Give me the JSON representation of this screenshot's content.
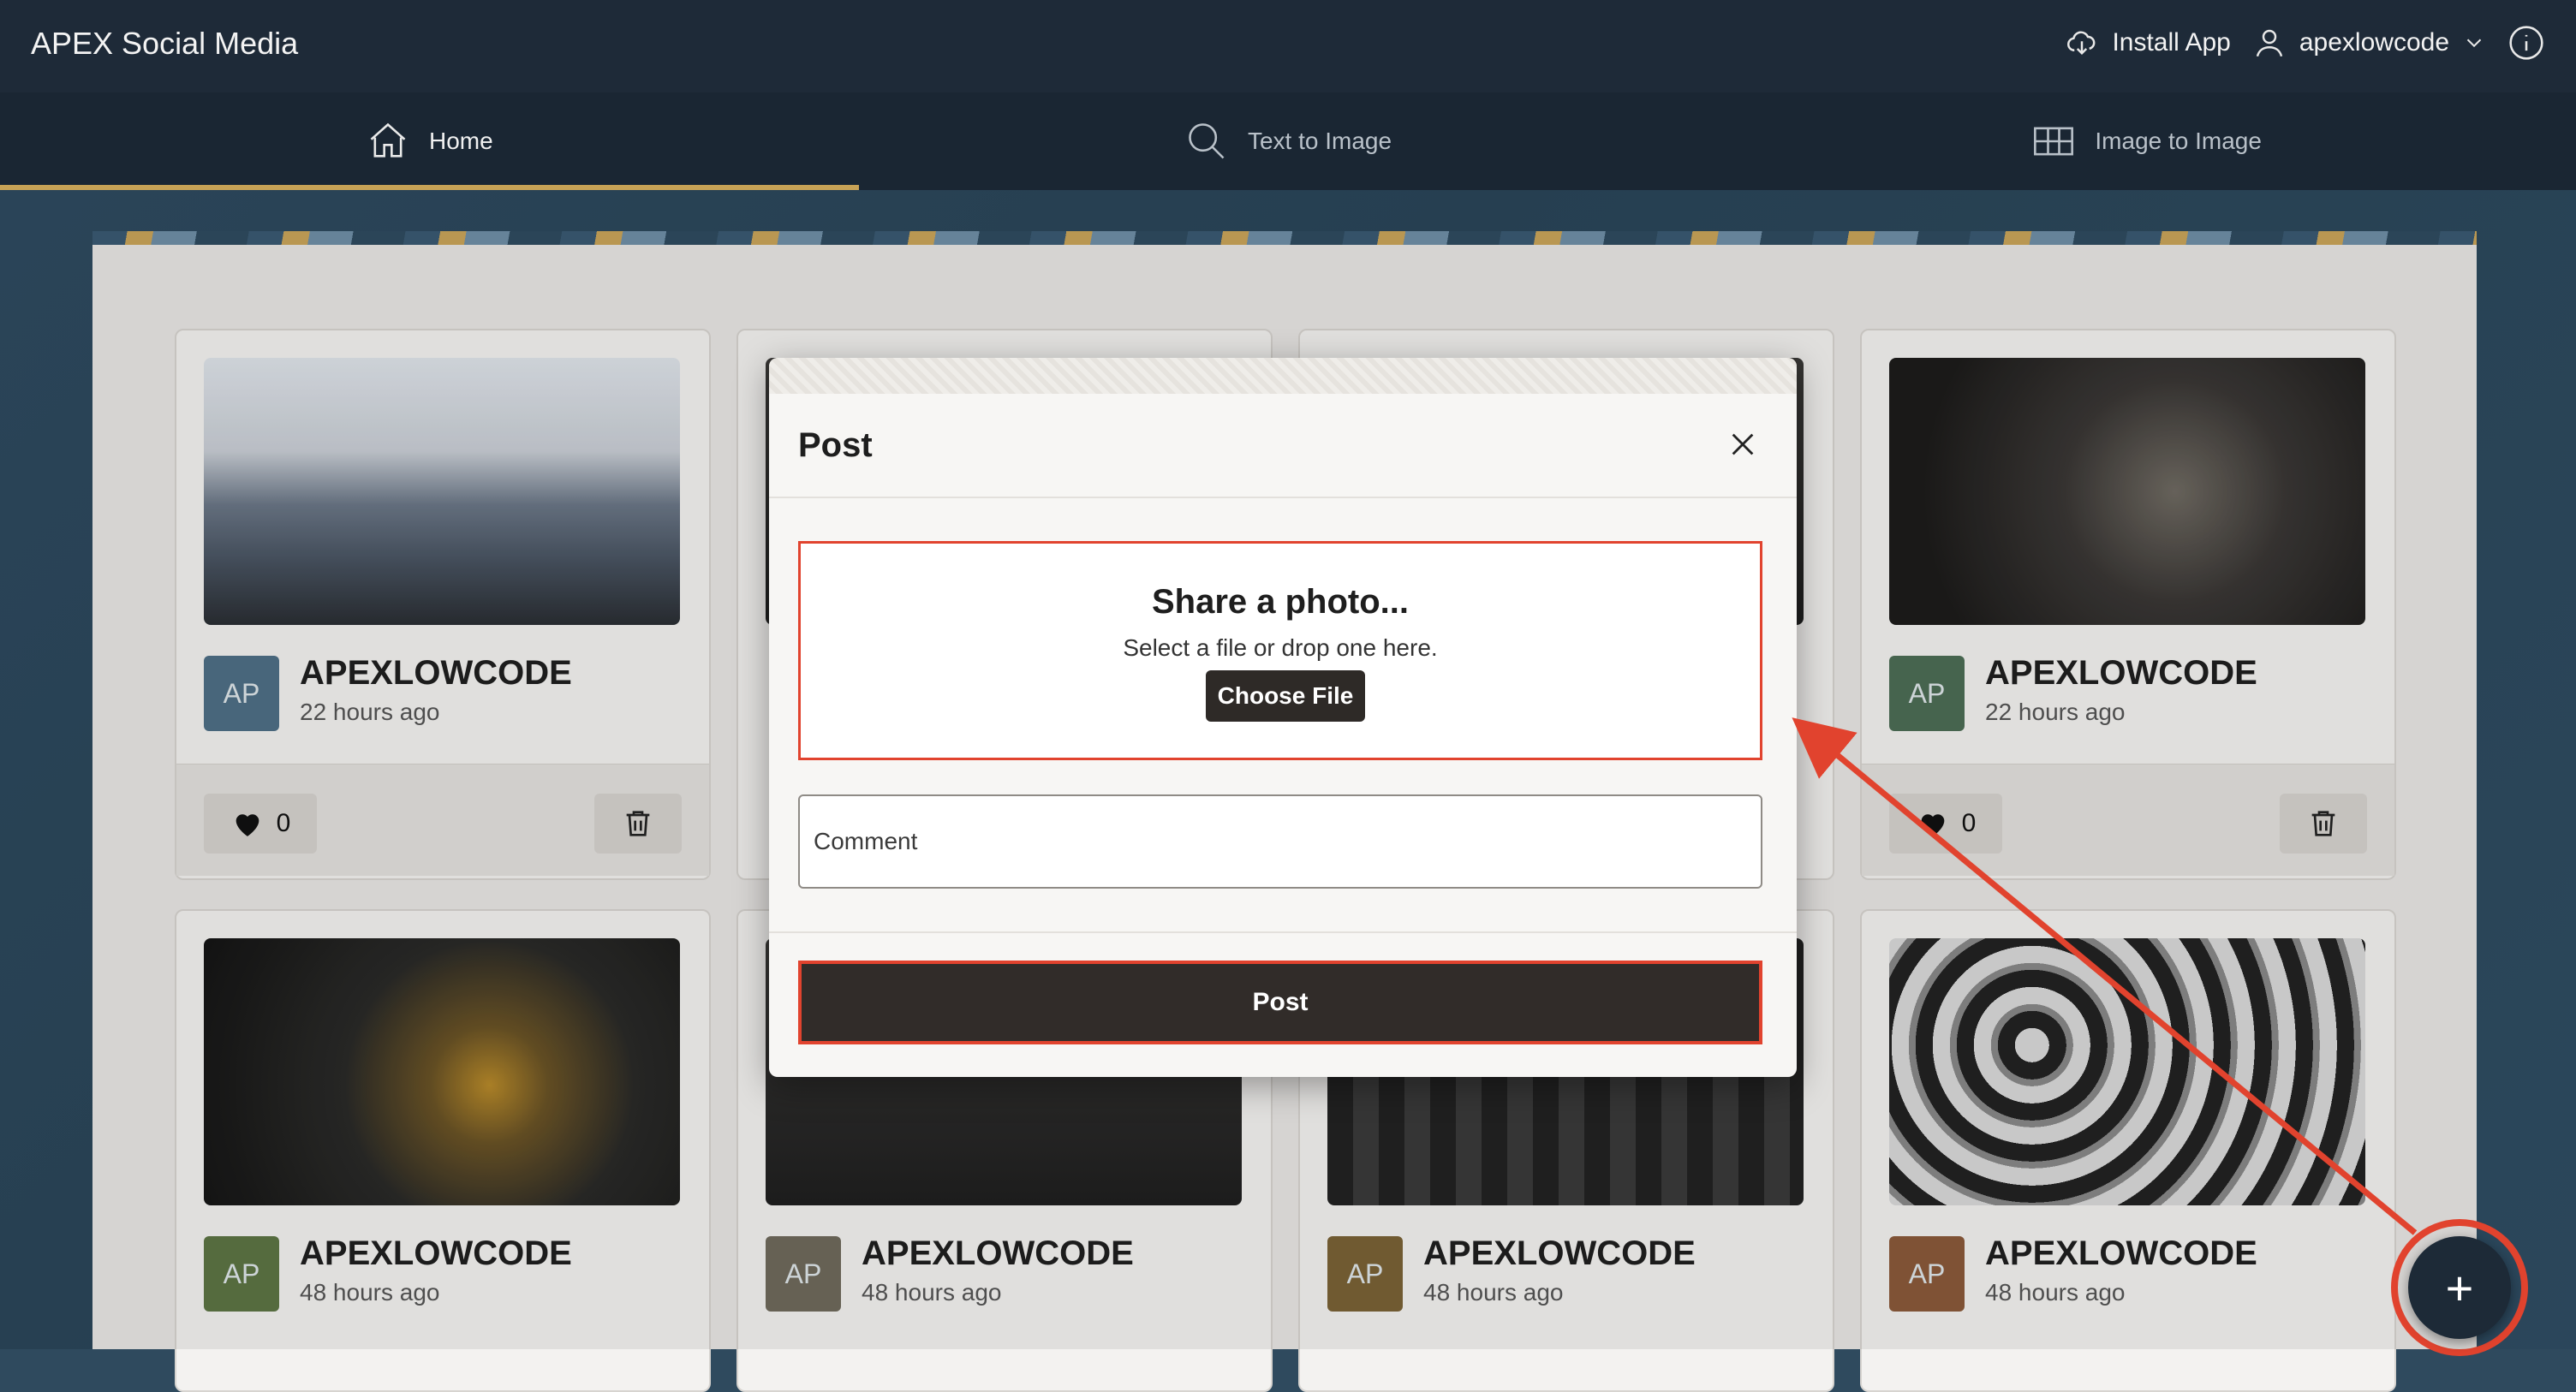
{
  "app": {
    "title": "APEX Social Media"
  },
  "header": {
    "install_label": "Install App",
    "user_label": "apexlowcode",
    "icons": {
      "install": "cloud-download-icon",
      "user": "user-icon",
      "chevron": "chevron-down-icon",
      "info": "info-icon"
    }
  },
  "tabs": [
    {
      "label": "Home",
      "icon": "home-icon",
      "active": true
    },
    {
      "label": "Text to Image",
      "icon": "search-icon",
      "active": false
    },
    {
      "label": "Image to Image",
      "icon": "grid-icon",
      "active": false
    }
  ],
  "cards": [
    {
      "initials": "AP",
      "author": "APEXLOWCODE",
      "time": "22 hours ago",
      "likes": "0",
      "avatar_color": "#4f6f86"
    },
    {
      "initials": "AP",
      "author": "APEXLOWCODE",
      "time": "22 hours ago",
      "likes": "0",
      "avatar_color": "#4d6d55"
    },
    {
      "initials": "AP",
      "author": "APEXLOWCODE",
      "time": "48 hours ago",
      "avatar_color": "#5d7544"
    },
    {
      "initials": "AP",
      "author": "APEXLOWCODE",
      "time": "48 hours ago",
      "avatar_color": "#6f6a5c"
    },
    {
      "initials": "AP",
      "author": "APEXLOWCODE",
      "time": "48 hours ago",
      "avatar_color": "#7a6236"
    },
    {
      "initials": "AP",
      "author": "APEXLOWCODE",
      "time": "48 hours ago",
      "avatar_color": "#8a5a3a"
    }
  ],
  "dialog": {
    "title": "Post",
    "dropzone_title": "Share a photo...",
    "dropzone_sub": "Select a file or drop one here.",
    "choose_label": "Choose File",
    "comment_placeholder": "Comment",
    "post_label": "Post"
  },
  "fab": {
    "label": "+"
  },
  "colors": {
    "accent": "#c7a256",
    "highlight": "#e1432e",
    "header": "#1e2a38"
  }
}
